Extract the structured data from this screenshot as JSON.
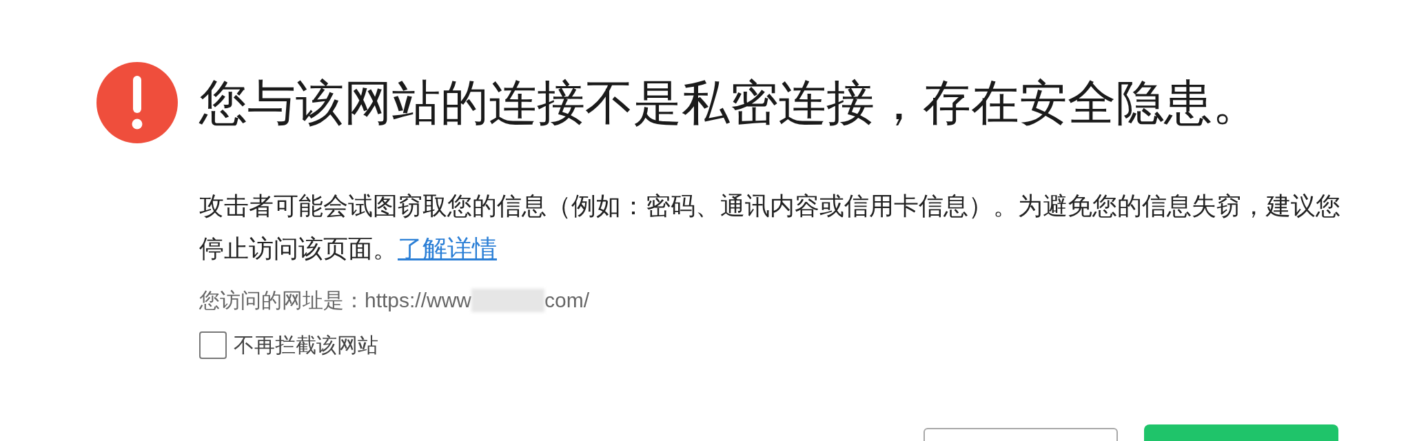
{
  "title": "您与该网站的连接不是私密连接，存在安全隐患。",
  "description": {
    "text": "攻击者可能会试图窃取您的信息（例如：密码、通讯内容或信用卡信息）。为避免您的信息失窃，建议您停止访问该页面。",
    "link": "了解详情"
  },
  "url": {
    "label": "您访问的网址是：",
    "prefix": "https://www",
    "suffix": "com/"
  },
  "checkbox": {
    "label": "不再拦截该网站",
    "checked": false
  },
  "buttons": [
    {
      "kind": "secondary"
    },
    {
      "kind": "primary"
    }
  ]
}
